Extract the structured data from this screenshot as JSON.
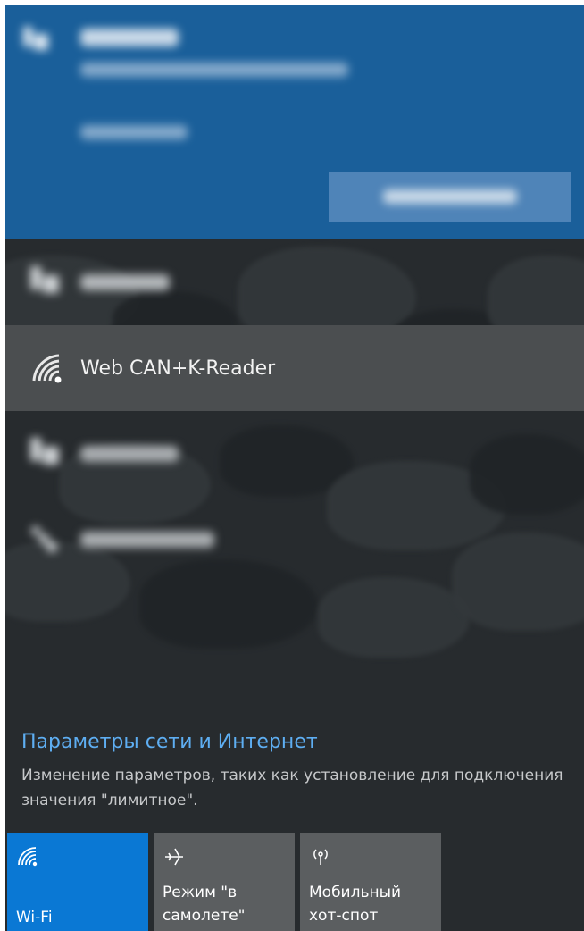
{
  "connected_network": {
    "name": "(blurred)",
    "status": "(blurred)",
    "properties_link": "(blurred)",
    "disconnect_label": "(blurred)"
  },
  "networks": [
    {
      "name": "(blurred)",
      "blurred": true
    },
    {
      "name": "Web CAN+K-Reader",
      "blurred": false,
      "hovered": true
    },
    {
      "name": "(blurred)",
      "blurred": true
    },
    {
      "name": "(blurred)",
      "blurred": true,
      "secured": false
    }
  ],
  "settings": {
    "title": "Параметры сети и Интернет",
    "description": "Изменение параметров, таких как установление для подключения значения \"лимитное\"."
  },
  "quick_actions": [
    {
      "label": "Wi-Fi",
      "icon": "wifi-icon",
      "active": true
    },
    {
      "label": "Режим \"в\nсамолете\"",
      "icon": "airplane-icon",
      "active": false
    },
    {
      "label": "Мобильный\nхот-спот",
      "icon": "hotspot-icon",
      "active": false
    }
  ],
  "colors": {
    "accent": "#0a78d4",
    "connected_bg": "#1a5f9a",
    "link": "#5eaef2",
    "panel_bg": "#272b2e"
  }
}
